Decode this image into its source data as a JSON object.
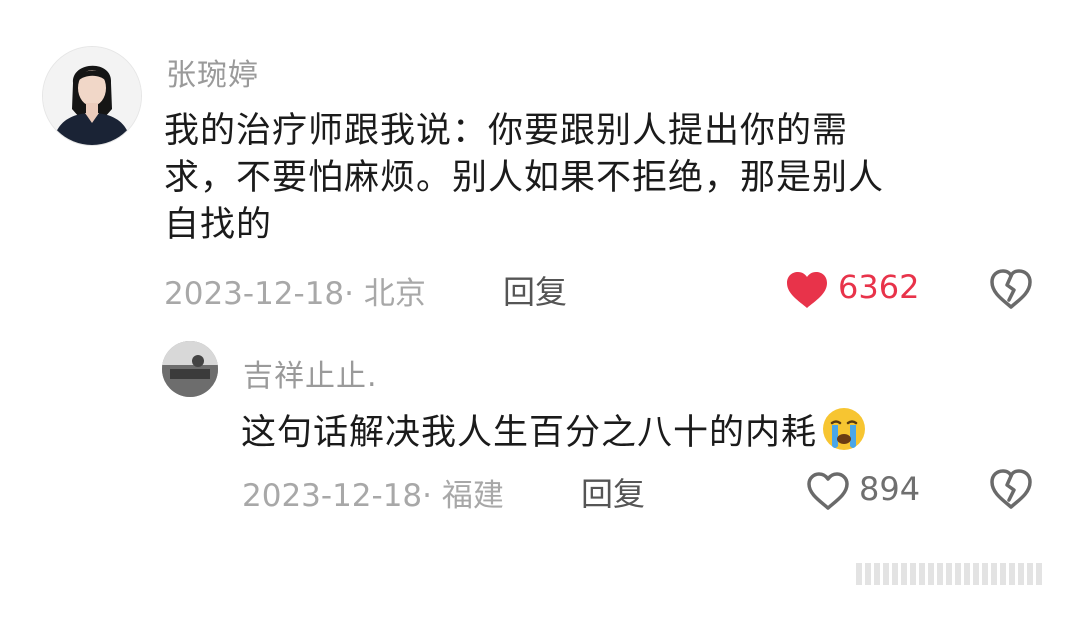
{
  "comment": {
    "username": "张琬婷",
    "text": "我的治疗师跟我说：你要跟别人提出你的需\n求，不要怕麻烦。别人如果不拒绝，那是别人\n自找的",
    "date": "2023-12-18",
    "location": "· 北京",
    "reply_label": "回复",
    "like_count": "6362",
    "liked": true,
    "accent_color": "#e8334a"
  },
  "reply": {
    "username": "吉祥止止.",
    "text": "这句话解决我人生百分之八十的内耗",
    "date": "2023-12-18",
    "location": "· 福建",
    "reply_label": "回复",
    "like_count": "894",
    "liked": false
  },
  "icons": {
    "like_filled": "heart-filled-icon",
    "like_outline": "heart-outline-icon",
    "dislike": "broken-heart-icon",
    "emoji": "crying-face-icon"
  }
}
